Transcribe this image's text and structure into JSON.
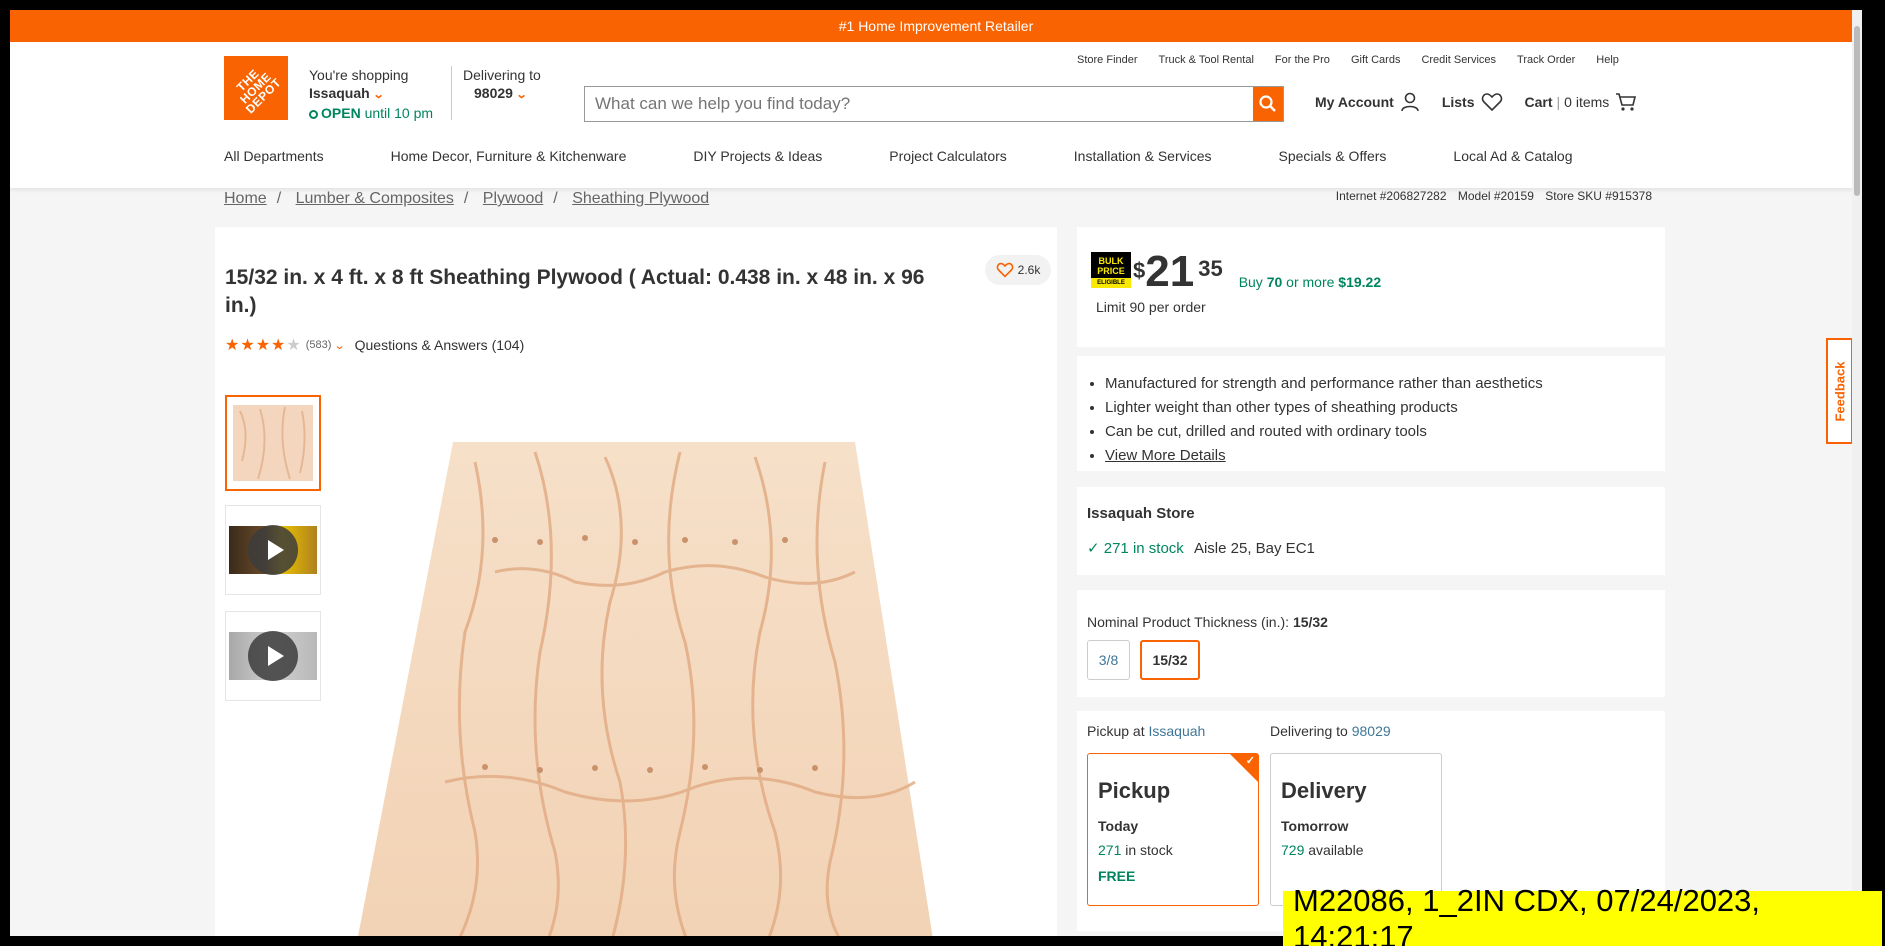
{
  "promo": {
    "text": "#1 Home Improvement Retailer"
  },
  "logo": {
    "text": "THE HOME DEPOT"
  },
  "store": {
    "label": "You're shopping",
    "name": "Issaquah",
    "open": "OPEN",
    "hours": "until 10 pm"
  },
  "delivery": {
    "label": "Delivering to",
    "zip": "98029"
  },
  "util_links": [
    "Store Finder",
    "Truck & Tool Rental",
    "For the Pro",
    "Gift Cards",
    "Credit Services",
    "Track Order",
    "Help"
  ],
  "search": {
    "placeholder": "What can we help you find today?"
  },
  "account": {
    "my_account": "My Account",
    "lists": "Lists",
    "cart": "Cart",
    "cart_count": "0 items"
  },
  "nav": [
    "All Departments",
    "Home Decor, Furniture & Kitchenware",
    "DIY Projects & Ideas",
    "Project Calculators",
    "Installation & Services",
    "Specials & Offers",
    "Local Ad & Catalog"
  ],
  "breadcrumbs": [
    "Home",
    "Lumber & Composites",
    "Plywood",
    "Sheathing Plywood"
  ],
  "ids": {
    "internet": "Internet #206827282",
    "model": "Model #20159",
    "sku": "Store SKU #915378"
  },
  "product": {
    "title": "15/32 in. x 4 ft. x 8 ft Sheathing Plywood ( Actual: 0.438 in. x 48 in. x 96 in.)",
    "favorites": "2.6k",
    "rating_value": 4,
    "rating_max": 5,
    "review_count": "(583)",
    "qa": "Questions & Answers (104)"
  },
  "price": {
    "bulk_line1": "BULK",
    "bulk_line2": "PRICE",
    "bulk_line3": "ELIGIBLE",
    "currency": "$",
    "dollars": "21",
    "cents": "35",
    "buy_prefix": "Buy",
    "buy_qty": "70",
    "buy_mid": "or more",
    "buy_price": "$19.22",
    "limit": "Limit 90 per order"
  },
  "highlights": [
    "Manufactured for strength and performance rather than aesthetics",
    "Lighter weight than other types of sheathing products",
    "Can be cut, drilled and routed with ordinary tools"
  ],
  "view_more": "View More Details",
  "store_stock": {
    "name": "Issaquah Store",
    "stock": "271 in stock",
    "location": "Aisle 25, Bay EC1"
  },
  "thickness": {
    "label": "Nominal Product Thickness (in.):",
    "selected": "15/32",
    "options": [
      "3/8",
      "15/32"
    ]
  },
  "fulfillment": {
    "pickup_label": "Pickup at",
    "pickup_store": "Issaquah",
    "deliver_label": "Delivering to",
    "deliver_zip": "98029",
    "pickup": {
      "title": "Pickup",
      "when": "Today",
      "qty": "271",
      "qty_suffix": "in stock",
      "cost": "FREE"
    },
    "delivery": {
      "title": "Delivery",
      "when": "Tomorrow",
      "qty": "729",
      "qty_suffix": "available"
    }
  },
  "feedback": "Feedback",
  "stamp": "M22086, 1_2IN CDX, 07/24/2023, 14:21:17",
  "colors": {
    "brand": "#f96302",
    "green": "#00855f",
    "link": "#3e7697"
  },
  "icons": [
    "search-icon",
    "account-icon",
    "heart-icon",
    "cart-icon",
    "play-icon",
    "check-icon",
    "chevron-down-icon",
    "feedback-icon"
  ]
}
